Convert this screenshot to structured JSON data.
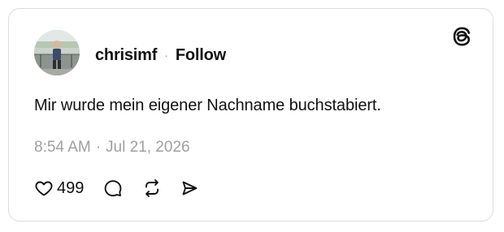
{
  "post": {
    "username": "chrisimf",
    "separator": "·",
    "follow_label": "Follow",
    "text": "Mir wurde mein eigener Nachname buchstabiert.",
    "time": "8:54 AM",
    "date_separator": "·",
    "date": "Jul 21, 2026",
    "like_count": "499"
  },
  "icons": {
    "brand": "threads-logo-icon",
    "like": "heart-icon",
    "reply": "comment-bubble-icon",
    "repost": "repost-icon",
    "share": "send-icon"
  },
  "colors": {
    "text": "#111111",
    "muted": "#a0a0a0",
    "border": "#dcdcdc"
  }
}
